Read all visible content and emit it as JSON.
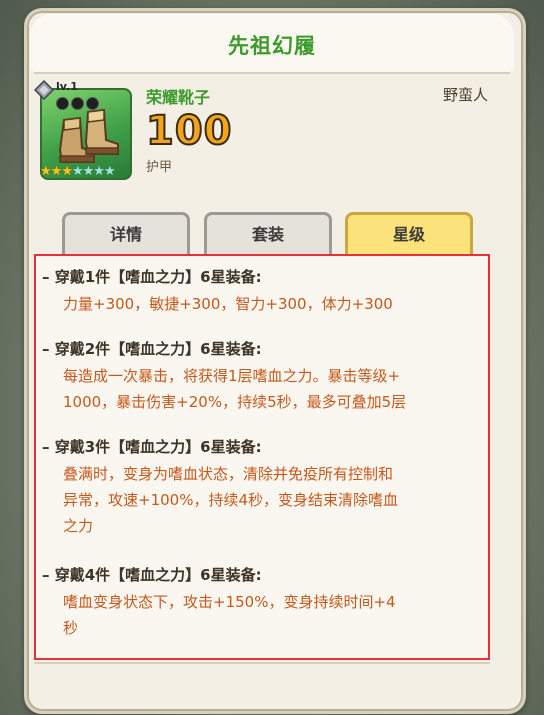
{
  "panel": {
    "title": "先祖幻履"
  },
  "item": {
    "level": "lv.1",
    "name": "荣耀靴子",
    "value": "100",
    "type": "护甲",
    "class": "野蛮人",
    "stars_filled": 3,
    "stars_total": 7
  },
  "tabs": [
    {
      "label": "详情",
      "active": false
    },
    {
      "label": "套装",
      "active": false
    },
    {
      "label": "星级",
      "active": true
    }
  ],
  "entries": [
    {
      "header": "– 穿戴1件【嗜血之力】6星装备:",
      "lines": [
        "力量+300，敏捷+300，智力+300，体力+300"
      ]
    },
    {
      "header": "– 穿戴2件【嗜血之力】6星装备:",
      "lines": [
        "每造成一次暴击，将获得1层嗜血之力。暴击等级+",
        "1000，暴击伤害+20%，持续5秒，最多可叠加5层"
      ]
    },
    {
      "header": "– 穿戴3件【嗜血之力】6星装备:",
      "lines": [
        "叠满时，变身为嗜血状态，清除并免疫所有控制和",
        "异常，攻速+100%，持续4秒，变身结束清除嗜血",
        "之力"
      ]
    },
    {
      "header": "– 穿戴4件【嗜血之力】6星装备:",
      "lines": [
        "嗜血变身状态下，攻击+150%，变身持续时间+4",
        "秒"
      ]
    }
  ],
  "colors": {
    "title_green": "#3e9a2d",
    "value_gold": "#f2a51c",
    "effect_orange": "#c6581b",
    "highlight_red": "#e5323a",
    "active_tab": "#fbe27a"
  },
  "icons": [
    "gem-icon",
    "boots-icon",
    "star-icon"
  ]
}
